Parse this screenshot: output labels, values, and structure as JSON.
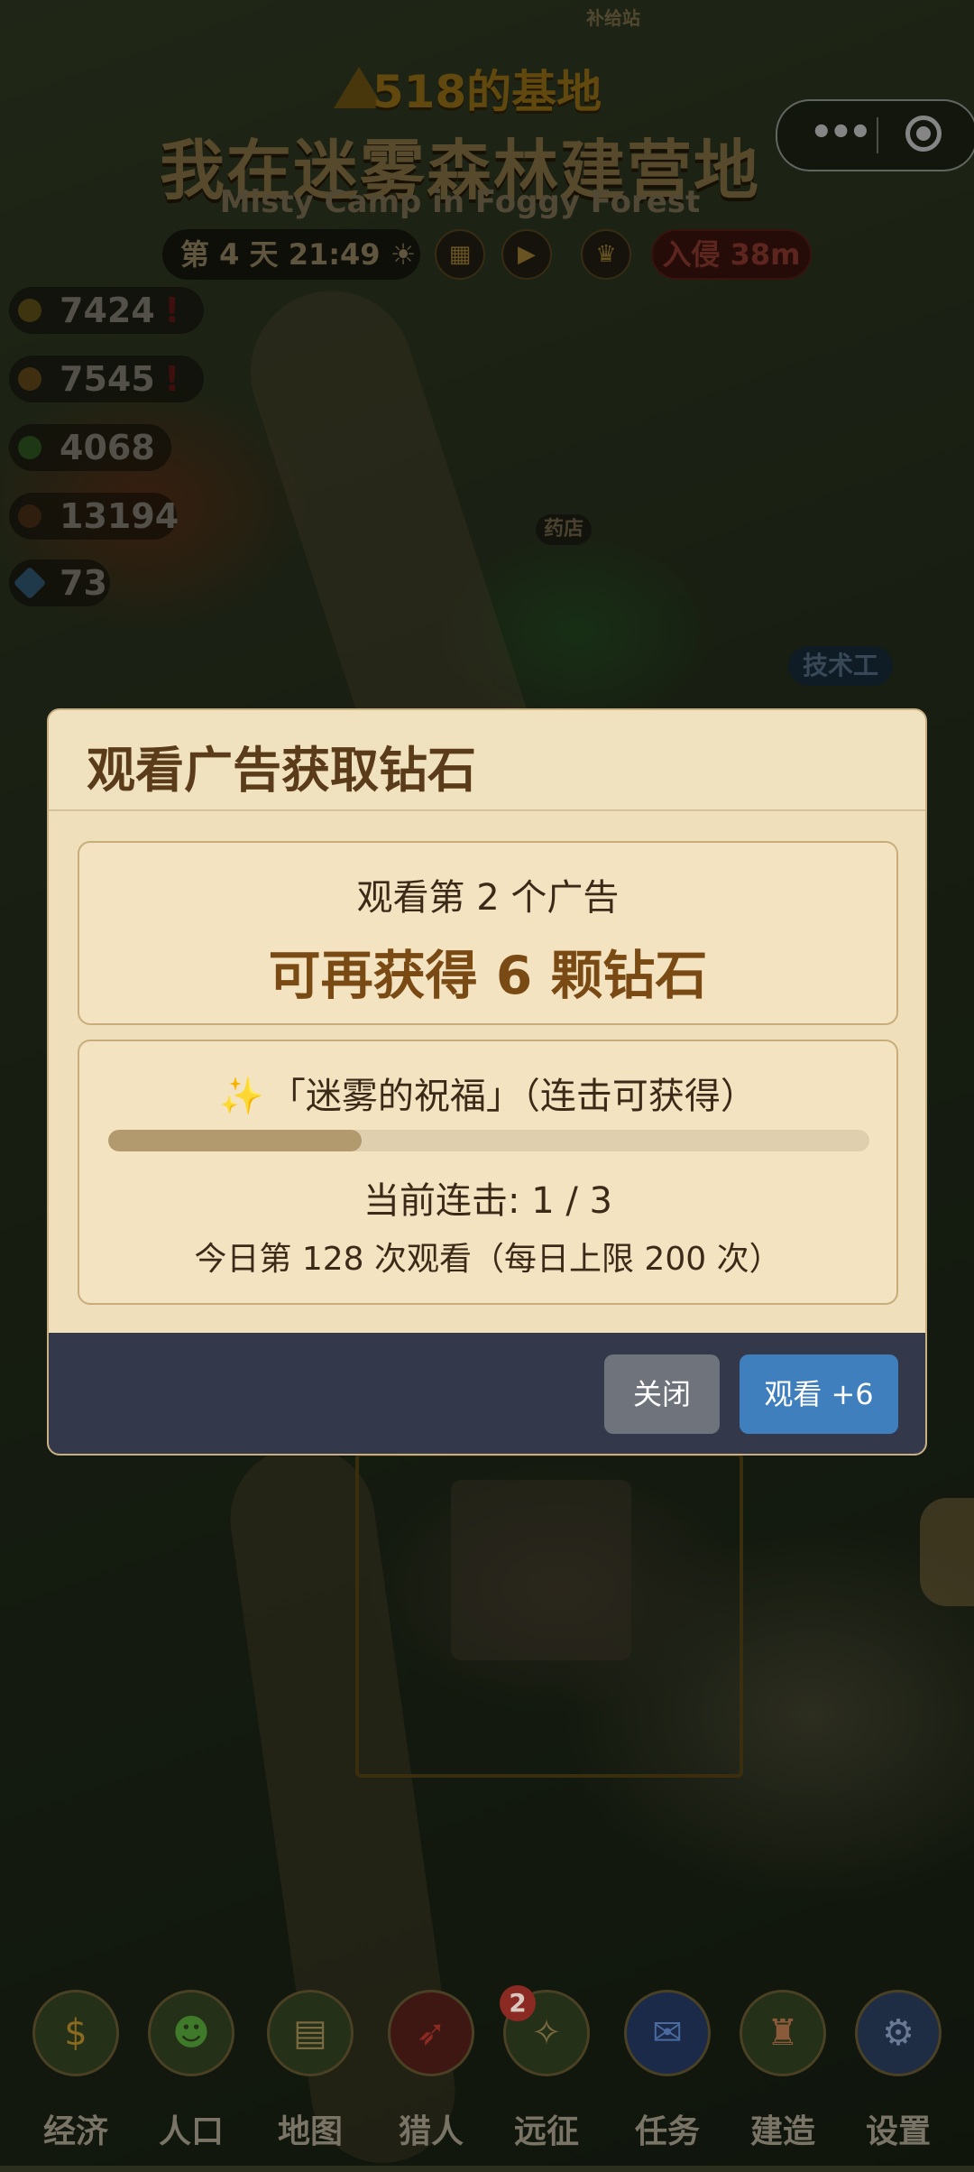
{
  "header": {
    "base_name": "518的基地",
    "title": "我在迷雾森林建营地",
    "subtitle": "Misty Camp in Foggy Forest",
    "supply_station": "补给站"
  },
  "status": {
    "day_time": "第 4 天  21:49 ☀",
    "invasion": "入侵 38m",
    "hud_icons": [
      "calendar-icon",
      "play-icon",
      "trophy-icon"
    ]
  },
  "resources": [
    {
      "icon": "coin-icon",
      "value": "7424",
      "warning": "!"
    },
    {
      "icon": "food-icon",
      "value": "7545",
      "warning": "!"
    },
    {
      "icon": "herb-icon",
      "value": "4068"
    },
    {
      "icon": "wood-icon",
      "value": "13194"
    },
    {
      "icon": "diamond-icon",
      "value": "73"
    }
  ],
  "map_labels": {
    "pharmacy": "药店",
    "technician": "技术工"
  },
  "modal": {
    "title": "观看广告获取钻石",
    "ad_index": "观看第 2 个广告",
    "reward": "可再获得 6 颗钻石",
    "blessing": "「迷雾的祝福」（连击可获得）",
    "combo_progress": 0.333,
    "combo": "当前连击: 1 / 3",
    "daily": "今日第 128 次观看（每日上限 200 次）",
    "close_label": "关闭",
    "watch_label": "观看 +6"
  },
  "nav": [
    {
      "label": "经济",
      "icon": "coin-icon"
    },
    {
      "label": "人口",
      "icon": "people-icon"
    },
    {
      "label": "地图",
      "icon": "map-icon"
    },
    {
      "label": "猎人",
      "icon": "bow-icon"
    },
    {
      "label": "远征",
      "icon": "compass-icon",
      "badge": "2"
    },
    {
      "label": "任务",
      "icon": "scroll-icon"
    },
    {
      "label": "建造",
      "icon": "castle-icon"
    },
    {
      "label": "设置",
      "icon": "gear-icon"
    }
  ],
  "colors": {
    "modal_bg": "#efdfbb",
    "modal_title": "#5b3c1a",
    "reward_text": "#7a4a14",
    "footer_bg": "#33394a",
    "close_button": "#6e737c",
    "watch_button": "#3f7fbd"
  }
}
